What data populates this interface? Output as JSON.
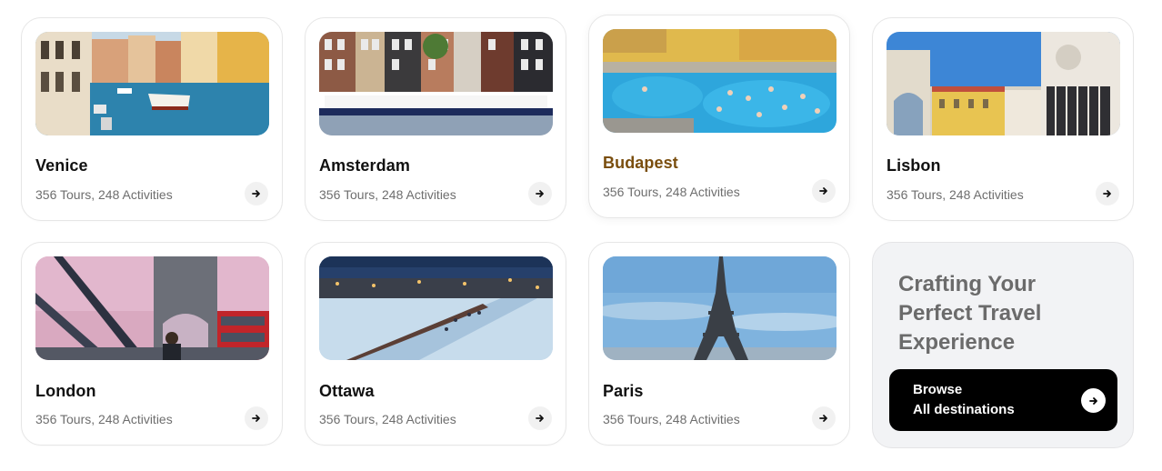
{
  "destinations": [
    {
      "city": "Venice",
      "meta": "356 Tours, 248 Activities",
      "image": "venice-canal-photo"
    },
    {
      "city": "Amsterdam",
      "meta": "356 Tours, 248 Activities",
      "image": "amsterdam-canal-houses-photo"
    },
    {
      "city": "Budapest",
      "meta": "356 Tours, 248 Activities",
      "image": "budapest-thermal-bath-photo"
    },
    {
      "city": "Lisbon",
      "meta": "356 Tours, 248 Activities",
      "image": "lisbon-arch-photo"
    },
    {
      "city": "London",
      "meta": "356 Tours, 248 Activities",
      "image": "london-tower-bridge-photo"
    },
    {
      "city": "Ottawa",
      "meta": "356 Tours, 248 Activities",
      "image": "ottawa-frozen-canal-photo"
    },
    {
      "city": "Paris",
      "meta": "356 Tours, 248 Activities",
      "image": "paris-eiffel-tower-photo"
    }
  ],
  "promo": {
    "title_line1": "Crafting Your",
    "title_line2": "Perfect Travel",
    "title_line3": "Experience",
    "button_line1": "Browse",
    "button_line2": "All destinations"
  },
  "colors": {
    "accent_hover_text": "#7a4e0e",
    "button_bg": "#000000",
    "promo_bg": "#f2f3f5"
  },
  "icons": {
    "card_action": "arrow-right-icon"
  }
}
